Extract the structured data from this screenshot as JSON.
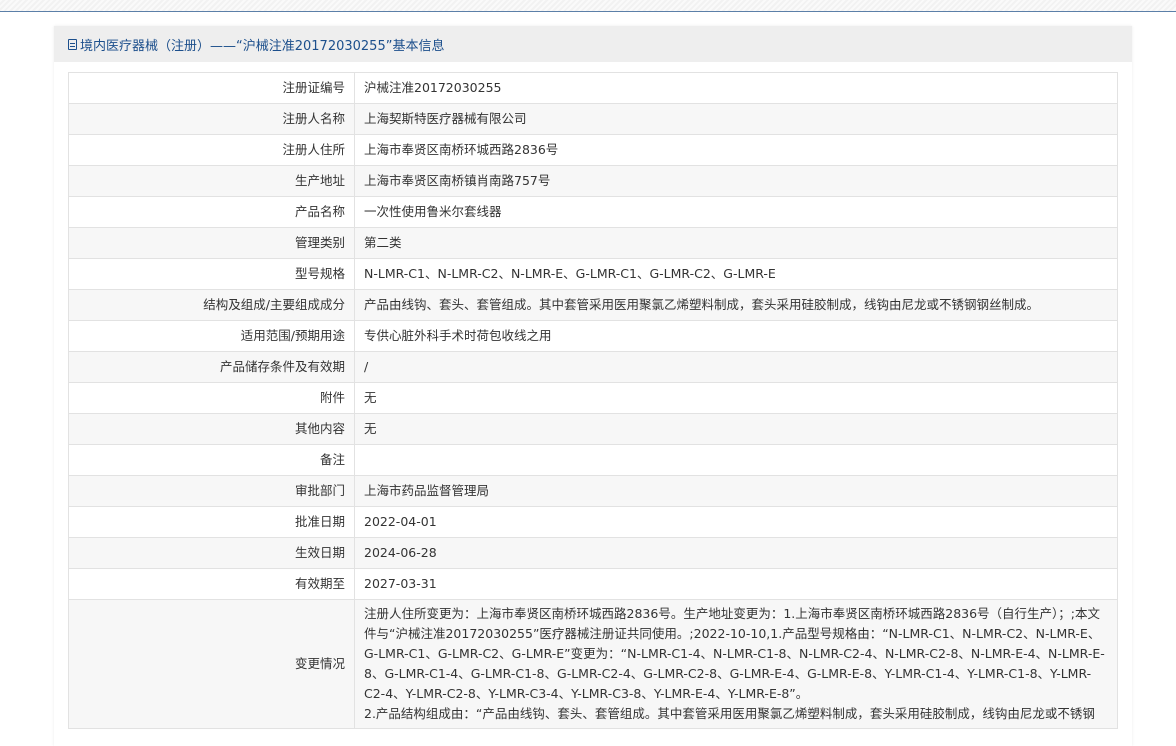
{
  "header": {
    "title": "境内医疗器械（注册）——“沪械注准20172030255”基本信息",
    "icon": "document-icon"
  },
  "rows": [
    {
      "label": "注册证编号",
      "value": "沪械注准20172030255"
    },
    {
      "label": "注册人名称",
      "value": "上海契斯特医疗器械有限公司"
    },
    {
      "label": "注册人住所",
      "value": "上海市奉贤区南桥环城西路2836号"
    },
    {
      "label": "生产地址",
      "value": "上海市奉贤区南桥镇肖南路757号"
    },
    {
      "label": "产品名称",
      "value": "一次性使用鲁米尔套线器"
    },
    {
      "label": "管理类别",
      "value": "第二类"
    },
    {
      "label": "型号规格",
      "value": "N-LMR-C1、N-LMR-C2、N-LMR-E、G-LMR-C1、G-LMR-C2、G-LMR-E"
    },
    {
      "label": "结构及组成/主要组成成分",
      "value": "产品由线钩、套头、套管组成。其中套管采用医用聚氯乙烯塑料制成，套头采用硅胶制成，线钩由尼龙或不锈钢钢丝制成。"
    },
    {
      "label": "适用范围/预期用途",
      "value": "专供心脏外科手术时荷包收线之用"
    },
    {
      "label": "产品储存条件及有效期",
      "value": "/"
    },
    {
      "label": "附件",
      "value": "无"
    },
    {
      "label": "其他内容",
      "value": "无"
    },
    {
      "label": "备注",
      "value": ""
    },
    {
      "label": "审批部门",
      "value": "上海市药品监督管理局"
    },
    {
      "label": "批准日期",
      "value": "2022-04-01"
    },
    {
      "label": "生效日期",
      "value": "2024-06-28"
    },
    {
      "label": "有效期至",
      "value": "2027-03-31"
    }
  ],
  "changes": {
    "label": "变更情况",
    "line1": "注册人住所变更为：上海市奉贤区南桥环城西路2836号。生产地址变更为：1.上海市奉贤区南桥环城西路2836号（自行生产）；;本文件与“沪械注准20172030255”医疗器械注册证共同使用。;2022-10-10,1.产品型号规格由：“N-LMR-C1、N-LMR-C2、N-LMR-E、G-LMR-C1、G-LMR-C2、G-LMR-E”变更为：“N-LMR-C1-4、N-LMR-C1-8、N-LMR-C2-4、N-LMR-C2-8、N-LMR-E-4、N-LMR-E-8、G-LMR-C1-4、G-LMR-C1-8、G-LMR-C2-4、G-LMR-C2-8、G-LMR-E-4、G-LMR-E-8、Y-LMR-C1-4、Y-LMR-C1-8、Y-LMR-C2-4、Y-LMR-C2-8、Y-LMR-C3-4、Y-LMR-C3-8、Y-LMR-E-4、Y-LMR-E-8”。",
    "line2": "2.产品结构组成由：“产品由线钩、套头、套管组成。其中套管采用医用聚氯乙烯塑料制成，套头采用硅胶制成，线钩由尼龙或不锈钢"
  }
}
